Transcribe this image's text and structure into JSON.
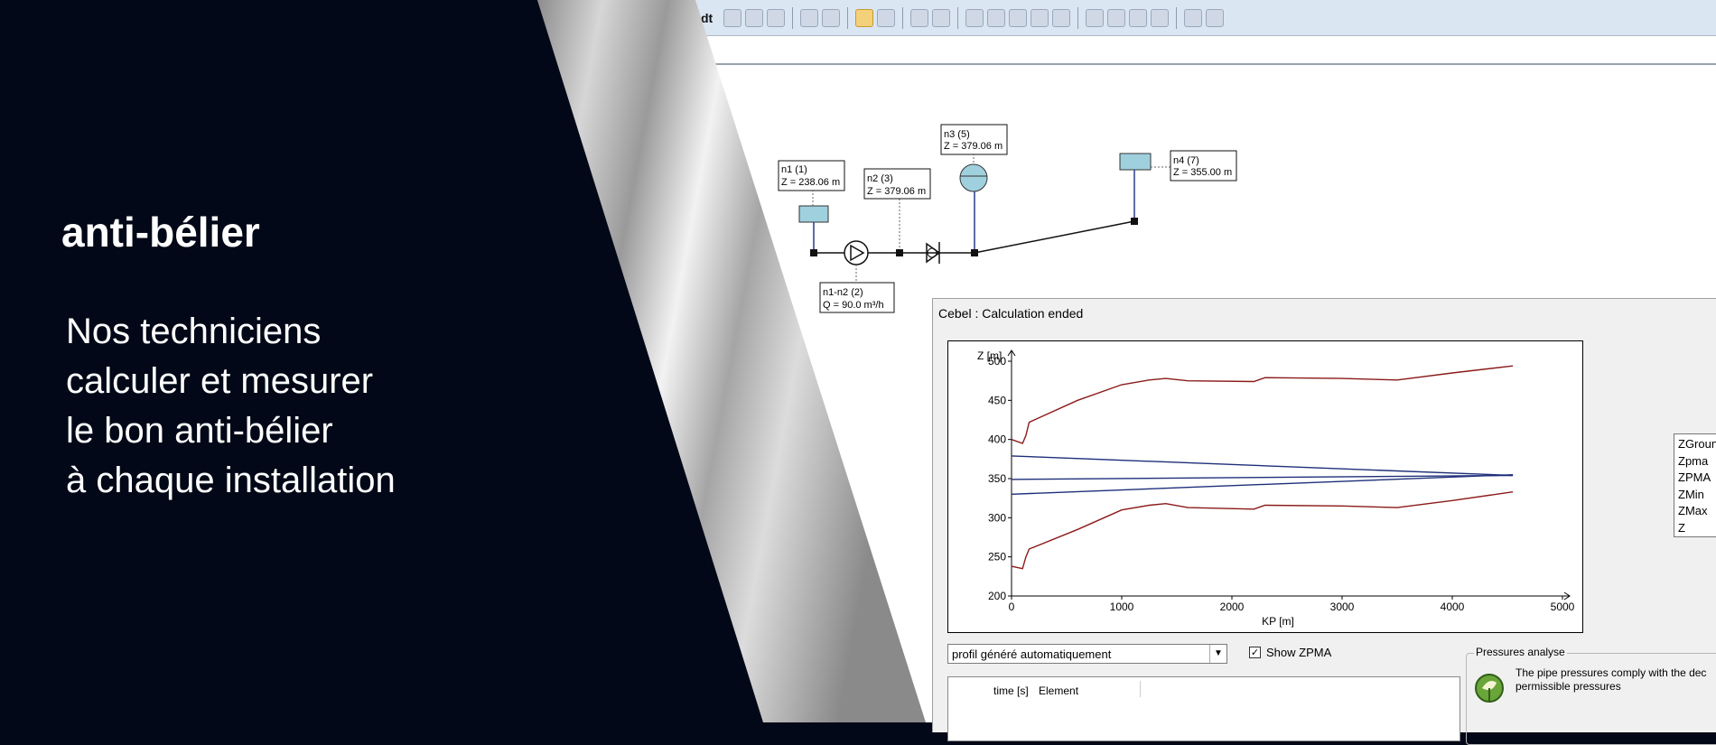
{
  "hero": {
    "title": "anti-bélier",
    "lines": [
      "Nos techniciens",
      "calculer et mesurer",
      "le bon anti-bélier",
      "à chaque installation"
    ]
  },
  "toolbar": {
    "partial_label": "dt"
  },
  "diagram": {
    "nodes": [
      {
        "label": "n1 (1)",
        "z": "Z = 238.06 m"
      },
      {
        "label": "n2 (3)",
        "z": "Z = 379.06 m"
      },
      {
        "label": "n3 (5)",
        "z": "Z = 379.06 m"
      },
      {
        "label": "n4 (7)",
        "z": "Z = 355.00 m"
      }
    ],
    "pipe": {
      "label": "n1-n2 (2)",
      "q": "Q = 90.0 m³/h"
    }
  },
  "dialog": {
    "title": "Cebel : Calculation ended",
    "profile_select": "profil généré automatiquement",
    "show_zpma_label": "Show ZPMA",
    "show_zpma_checked": true,
    "results_headers": [
      "time [s]",
      "Element"
    ],
    "pressures_title": "Pressures analyse",
    "pressures_message_1": "The pipe pressures comply with the dec",
    "pressures_message_2": "permissible pressures"
  },
  "colors": {
    "background_dark": "#020817",
    "envelope_lines": "#8b1a1a",
    "pressure_lines": "#1f2f7a",
    "tank_fill": "#9fd0de"
  },
  "chart_data": {
    "type": "line",
    "ylabel": "Z [m]",
    "xlabel": "KP [m]",
    "xlim": [
      0,
      5000
    ],
    "ylim": [
      200,
      500
    ],
    "xticks": [
      0,
      1000,
      2000,
      3000,
      4000,
      5000
    ],
    "yticks": [
      200,
      250,
      300,
      350,
      400,
      450,
      500
    ],
    "legend": [
      "ZGroun",
      "Zpma",
      "ZPMA",
      "ZMin",
      "ZMax",
      "Z"
    ],
    "legend_position": "right",
    "series": [
      {
        "name": "upper envelope",
        "color": "#8b1a1a",
        "x": [
          0,
          100,
          130,
          160,
          600,
          1000,
          1250,
          1400,
          1600,
          2200,
          2300,
          3000,
          3500,
          4000,
          4550
        ],
        "y": [
          400,
          395,
          405,
          422,
          450,
          470,
          476,
          478,
          475,
          474,
          479,
          478,
          476,
          485,
          494
        ]
      },
      {
        "name": "lower envelope",
        "color": "#8b1a1a",
        "x": [
          0,
          100,
          130,
          160,
          600,
          1000,
          1250,
          1400,
          1600,
          2200,
          2300,
          3000,
          3500,
          4000,
          4550
        ],
        "y": [
          238,
          235,
          250,
          260,
          285,
          310,
          316,
          318,
          313,
          311,
          316,
          315,
          313,
          322,
          333
        ]
      },
      {
        "name": "pressure line 1",
        "color": "#1f2f7a",
        "x": [
          0,
          4550
        ],
        "y": [
          379,
          354
        ]
      },
      {
        "name": "pressure line 2",
        "color": "#1f2f7a",
        "x": [
          0,
          4550
        ],
        "y": [
          349,
          354
        ]
      },
      {
        "name": "pressure line 3",
        "color": "#1f2f7a",
        "x": [
          0,
          4550
        ],
        "y": [
          330,
          355
        ]
      }
    ]
  }
}
